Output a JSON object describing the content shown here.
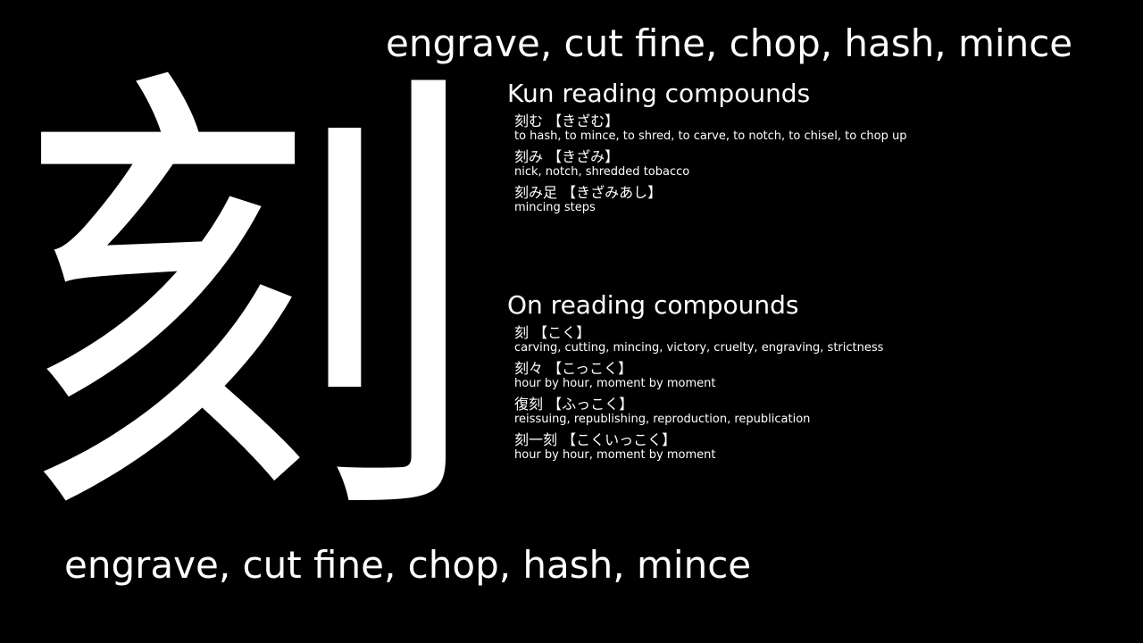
{
  "kanji": "刻",
  "meaning_top": "engrave, cut fine, chop, hash, mince",
  "meaning_bottom": "engrave, cut fine, chop, hash, mince",
  "kun": {
    "title": "Kun reading compounds",
    "entries": [
      {
        "head": "刻む 【きざむ】",
        "gloss": "to hash, to mince, to shred, to carve, to notch, to chisel, to chop up"
      },
      {
        "head": "刻み 【きざみ】",
        "gloss": "nick, notch, shredded tobacco"
      },
      {
        "head": "刻み足 【きざみあし】",
        "gloss": "mincing steps"
      }
    ]
  },
  "on": {
    "title": "On reading compounds",
    "entries": [
      {
        "head": "刻 【こく】",
        "gloss": "carving, cutting, mincing, victory, cruelty, engraving, strictness"
      },
      {
        "head": "刻々 【こっこく】",
        "gloss": "hour by hour, moment by moment"
      },
      {
        "head": "復刻 【ふっこく】",
        "gloss": "reissuing, republishing, reproduction, republication"
      },
      {
        "head": "刻一刻 【こくいっこく】",
        "gloss": "hour by hour, moment by moment"
      }
    ]
  },
  "colors": {
    "background": "#000000",
    "text": "#ffffff"
  }
}
